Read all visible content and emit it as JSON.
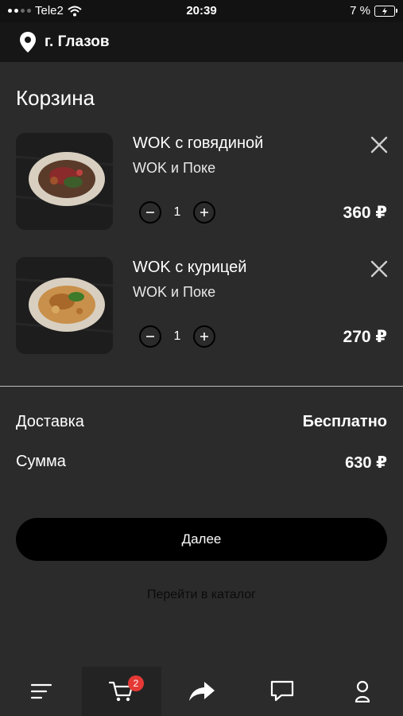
{
  "status_bar": {
    "carrier": "Tele2",
    "time": "20:39",
    "battery_percent": "7 %",
    "wifi_icon": "wifi-icon",
    "battery_icon": "battery-charging-icon"
  },
  "location": {
    "city": "г. Глазов",
    "icon": "map-pin-icon"
  },
  "page": {
    "title": "Корзина"
  },
  "cart": {
    "items": [
      {
        "name": "WOK с говядиной",
        "category": "WOK и Поке",
        "quantity": "1",
        "price": "360 ₽",
        "image": "beef-wok-dish-photo"
      },
      {
        "name": "WOK с курицей",
        "category": "WOK и Поке",
        "quantity": "1",
        "price": "270 ₽",
        "image": "chicken-wok-dish-photo"
      }
    ]
  },
  "summary": {
    "delivery_label": "Доставка",
    "delivery_value": "Бесплатно",
    "total_label": "Сумма",
    "total_value": "630 ₽"
  },
  "actions": {
    "next_label": "Далее",
    "catalog_link": "Перейти в каталог"
  },
  "tabbar": {
    "tabs": [
      "menu-icon",
      "cart-icon",
      "share-icon",
      "chat-icon",
      "profile-icon"
    ],
    "active": "cart-icon",
    "cart_badge": "2",
    "badge_color": "#e53935"
  }
}
